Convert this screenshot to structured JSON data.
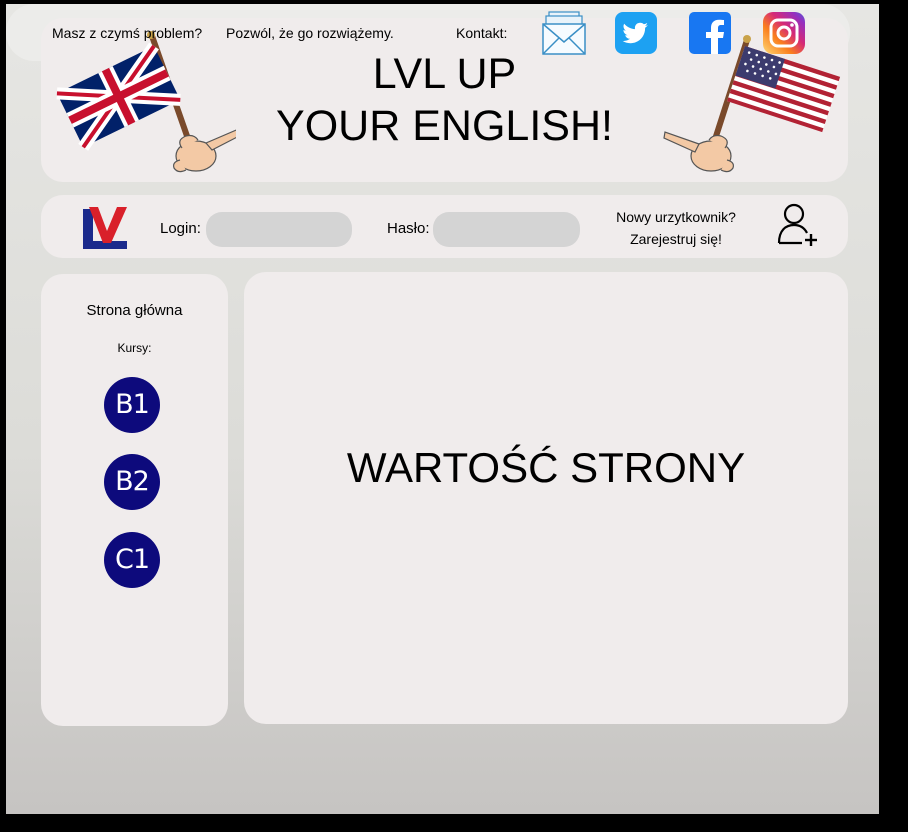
{
  "header": {
    "title_line1": "LVL UP",
    "title_line2": "YOUR ENGLISH!"
  },
  "login_bar": {
    "logo": "lvl-logo",
    "login_label": "Login:",
    "login_value": "",
    "password_label": "Hasło:",
    "password_value": "",
    "new_user_line1": "Nowy urzytkownik?",
    "new_user_line2": "Zarejestruj się!",
    "add_user_icon": "add-user-icon"
  },
  "sidebar": {
    "home": "Strona główna",
    "courses_label": "Kursy:",
    "courses": [
      "B1",
      "B2",
      "C1"
    ]
  },
  "main": {
    "value": "WARTOŚĆ STRONY"
  },
  "footer": {
    "problem": "Masz z czymś problem?",
    "solve": "Pozwól, że go rozwiążemy.",
    "contact": "Kontakt:",
    "icons": [
      "mail-icon",
      "twitter-icon",
      "facebook-icon",
      "instagram-icon"
    ]
  },
  "colors": {
    "panel": "#f0ecec",
    "course_badge": "#0d0a7c",
    "input": "#d4d4d4",
    "twitter": "#1da1f2",
    "facebook": "#1877f2"
  }
}
